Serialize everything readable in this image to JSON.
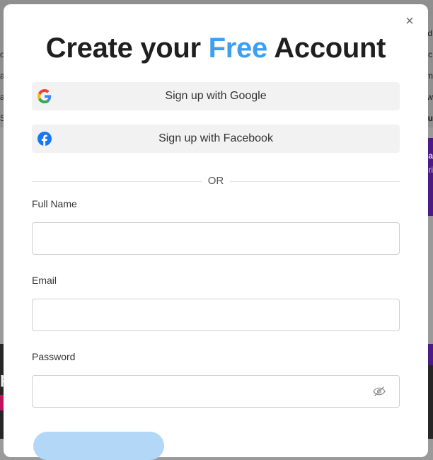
{
  "modal": {
    "title_prefix": "Create your",
    "title_accent": "Free",
    "title_suffix": "Account",
    "close_glyph": "×"
  },
  "social": {
    "google_label": "Sign up with Google",
    "facebook_label": "Sign up with Facebook",
    "google_icon": "google-icon",
    "facebook_icon": "facebook-icon"
  },
  "divider": {
    "text": "OR"
  },
  "form": {
    "full_name_label": "Full Name",
    "full_name_value": "",
    "email_label": "Email",
    "email_value": "",
    "password_label": "Password",
    "password_value": "",
    "password_toggle_icon": "eye-slash-icon"
  },
  "background": {
    "fragments": [
      "d",
      "c",
      "m",
      "ow",
      "ru",
      "a",
      "ri",
      "o",
      "a",
      "a",
      "S",
      "p"
    ]
  },
  "colors": {
    "accent": "#3d9ff0",
    "social_bg": "#f2f2f2",
    "facebook_blue": "#1877f2",
    "submit_bg": "#b3d8f7"
  }
}
